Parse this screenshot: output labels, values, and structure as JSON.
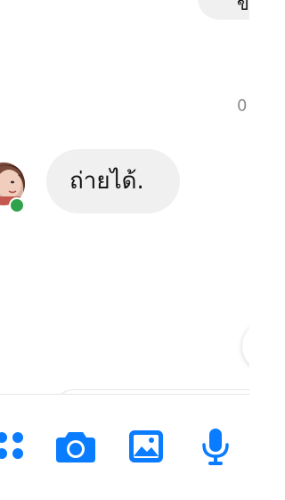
{
  "conversation": {
    "sent_message_fragment": "ข",
    "timestamp_fragment": "0",
    "received_message": "ถ่ายได้.",
    "sender_online": true
  },
  "composer": {
    "tools": [
      {
        "name": "more-actions",
        "icon": "apps-icon"
      },
      {
        "name": "camera",
        "icon": "camera-icon"
      },
      {
        "name": "gallery",
        "icon": "image-icon"
      },
      {
        "name": "voice",
        "icon": "microphone-icon"
      }
    ]
  },
  "colors": {
    "accent": "#0a7cff",
    "bubble_background": "#f0f0f0",
    "online_indicator": "#31a24c",
    "timestamp_text": "#8a8d91"
  }
}
